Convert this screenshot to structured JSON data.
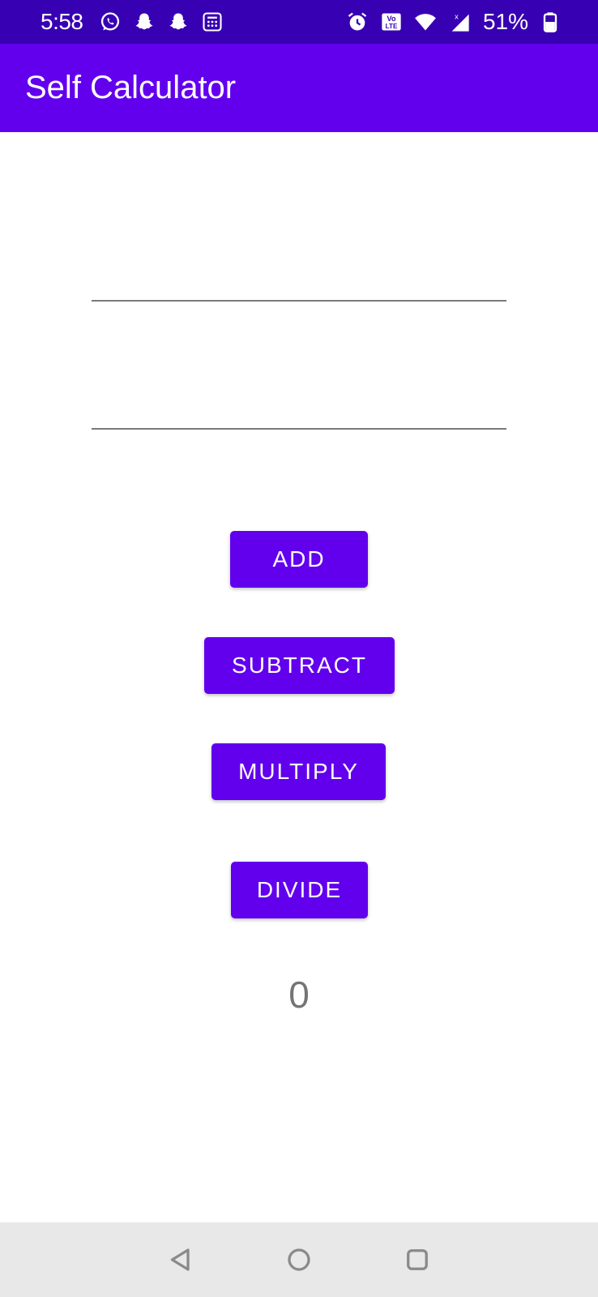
{
  "status_bar": {
    "time": "5:58",
    "battery_percent": "51%",
    "left_icons": [
      "whatsapp-icon",
      "snapchat-icon",
      "snapchat-icon",
      "calculator-app-icon"
    ],
    "right_icons": [
      "alarm-icon",
      "volte-icon",
      "wifi-icon",
      "signal-icon",
      "battery-icon"
    ],
    "background_color": "#3700b3"
  },
  "app_bar": {
    "title": "Self Calculator",
    "background_color": "#6200ee"
  },
  "inputs": {
    "first": {
      "value": "",
      "placeholder": ""
    },
    "second": {
      "value": "",
      "placeholder": ""
    }
  },
  "buttons": {
    "add": "ADD",
    "subtract": "SUBTRACT",
    "multiply": "MULTIPLY",
    "divide": "DIVIDE",
    "color": "#6200ee"
  },
  "result": {
    "value": "0"
  },
  "nav_bar": {
    "icons": [
      "back-icon",
      "home-icon",
      "recents-icon"
    ]
  }
}
